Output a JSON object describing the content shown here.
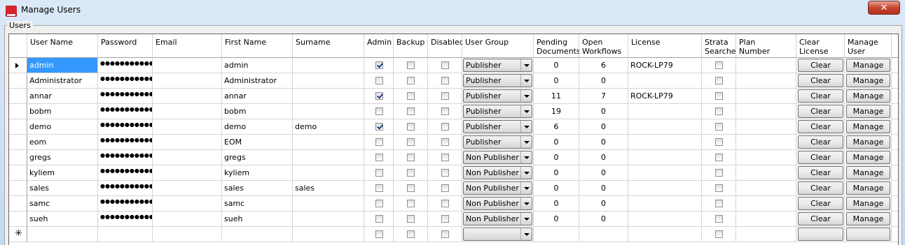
{
  "window": {
    "title": "Manage Users",
    "close_label": "✕"
  },
  "group": {
    "label": "Users"
  },
  "columns": [
    {
      "key": "user",
      "label": "User Name"
    },
    {
      "key": "password",
      "label": "Password"
    },
    {
      "key": "email",
      "label": "Email"
    },
    {
      "key": "first",
      "label": "First Name"
    },
    {
      "key": "surname",
      "label": "Surname"
    },
    {
      "key": "admin",
      "label": "Admin"
    },
    {
      "key": "backup",
      "label": "Backup"
    },
    {
      "key": "disabled",
      "label": "Disabled"
    },
    {
      "key": "group",
      "label": "User Group"
    },
    {
      "key": "pending",
      "label": "Pending\nDocuments"
    },
    {
      "key": "open",
      "label": "Open\nWorkflows"
    },
    {
      "key": "license",
      "label": "License"
    },
    {
      "key": "strata",
      "label": "Strata\nSearcher"
    },
    {
      "key": "plan",
      "label": "Plan\nNumber"
    },
    {
      "key": "clear",
      "label": "Clear\nLicense"
    },
    {
      "key": "manage",
      "label": "Manage\nUser"
    }
  ],
  "rows": [
    {
      "user": "admin",
      "password": "●●●●●●●●●●●",
      "email": "",
      "first": "admin",
      "surname": "",
      "admin": true,
      "backup": false,
      "disabled": false,
      "group": "Publisher",
      "pending": "0",
      "open": "6",
      "license": "ROCK-LP79",
      "strata": false,
      "plan": "",
      "clear": "Clear",
      "manage": "Manage"
    },
    {
      "user": "Administrator",
      "password": "●●●●●●●●●●●",
      "email": "",
      "first": "Administrator",
      "surname": "",
      "admin": false,
      "backup": false,
      "disabled": false,
      "group": "Publisher",
      "pending": "0",
      "open": "0",
      "license": "",
      "strata": false,
      "plan": "",
      "clear": "Clear",
      "manage": "Manage"
    },
    {
      "user": "annar",
      "password": "●●●●●●●●●●●",
      "email": "",
      "first": "annar",
      "surname": "",
      "admin": true,
      "backup": false,
      "disabled": false,
      "group": "Publisher",
      "pending": "11",
      "open": "7",
      "license": "ROCK-LP79",
      "strata": false,
      "plan": "",
      "clear": "Clear",
      "manage": "Manage"
    },
    {
      "user": "bobm",
      "password": "●●●●●●●●●●●",
      "email": "",
      "first": "bobm",
      "surname": "",
      "admin": false,
      "backup": false,
      "disabled": false,
      "group": "Publisher",
      "pending": "19",
      "open": "0",
      "license": "",
      "strata": false,
      "plan": "",
      "clear": "Clear",
      "manage": "Manage"
    },
    {
      "user": "demo",
      "password": "●●●●●●●●●●●",
      "email": "",
      "first": "demo",
      "surname": "demo",
      "admin": true,
      "backup": false,
      "disabled": false,
      "group": "Publisher",
      "pending": "6",
      "open": "0",
      "license": "",
      "strata": false,
      "plan": "",
      "clear": "Clear",
      "manage": "Manage"
    },
    {
      "user": "eom",
      "password": "●●●●●●●●●●●",
      "email": "",
      "first": "EOM",
      "surname": "",
      "admin": false,
      "backup": false,
      "disabled": false,
      "group": "Publisher",
      "pending": "0",
      "open": "0",
      "license": "",
      "strata": false,
      "plan": "",
      "clear": "Clear",
      "manage": "Manage"
    },
    {
      "user": "gregs",
      "password": "●●●●●●●●●●●",
      "email": "",
      "first": "gregs",
      "surname": "",
      "admin": false,
      "backup": false,
      "disabled": false,
      "group": "Non Publisher",
      "pending": "0",
      "open": "0",
      "license": "",
      "strata": false,
      "plan": "",
      "clear": "Clear",
      "manage": "Manage"
    },
    {
      "user": "kyliem",
      "password": "●●●●●●●●●●●",
      "email": "",
      "first": "kyliem",
      "surname": "",
      "admin": false,
      "backup": false,
      "disabled": false,
      "group": "Non Publisher",
      "pending": "0",
      "open": "0",
      "license": "",
      "strata": false,
      "plan": "",
      "clear": "Clear",
      "manage": "Manage"
    },
    {
      "user": "sales",
      "password": "●●●●●●●●●●●",
      "email": "",
      "first": "sales",
      "surname": "sales",
      "admin": false,
      "backup": false,
      "disabled": false,
      "group": "Non Publisher",
      "pending": "0",
      "open": "0",
      "license": "",
      "strata": false,
      "plan": "",
      "clear": "Clear",
      "manage": "Manage"
    },
    {
      "user": "samc",
      "password": "●●●●●●●●●●●",
      "email": "",
      "first": "samc",
      "surname": "",
      "admin": false,
      "backup": false,
      "disabled": false,
      "group": "Non Publisher",
      "pending": "0",
      "open": "0",
      "license": "",
      "strata": false,
      "plan": "",
      "clear": "Clear",
      "manage": "Manage"
    },
    {
      "user": "sueh",
      "password": "●●●●●●●●●●●",
      "email": "",
      "first": "sueh",
      "surname": "",
      "admin": false,
      "backup": false,
      "disabled": false,
      "group": "Non Publisher",
      "pending": "0",
      "open": "0",
      "license": "",
      "strata": false,
      "plan": "",
      "clear": "Clear",
      "manage": "Manage"
    },
    {
      "user": "",
      "password": "",
      "email": "",
      "first": "",
      "surname": "",
      "admin": false,
      "backup": false,
      "disabled": false,
      "group": "",
      "pending": "",
      "open": "",
      "license": "",
      "strata": false,
      "plan": "",
      "clear": "",
      "manage": ""
    }
  ],
  "selected_row": 0,
  "new_row": 11,
  "icons": {
    "current_row": "row-pointer-icon",
    "new_row": "new-row-icon",
    "app": "app-icon",
    "close": "close-icon"
  },
  "colors": {
    "selection": "#3399ff",
    "close": "#c74531",
    "title_bg": "#c9dff3"
  }
}
